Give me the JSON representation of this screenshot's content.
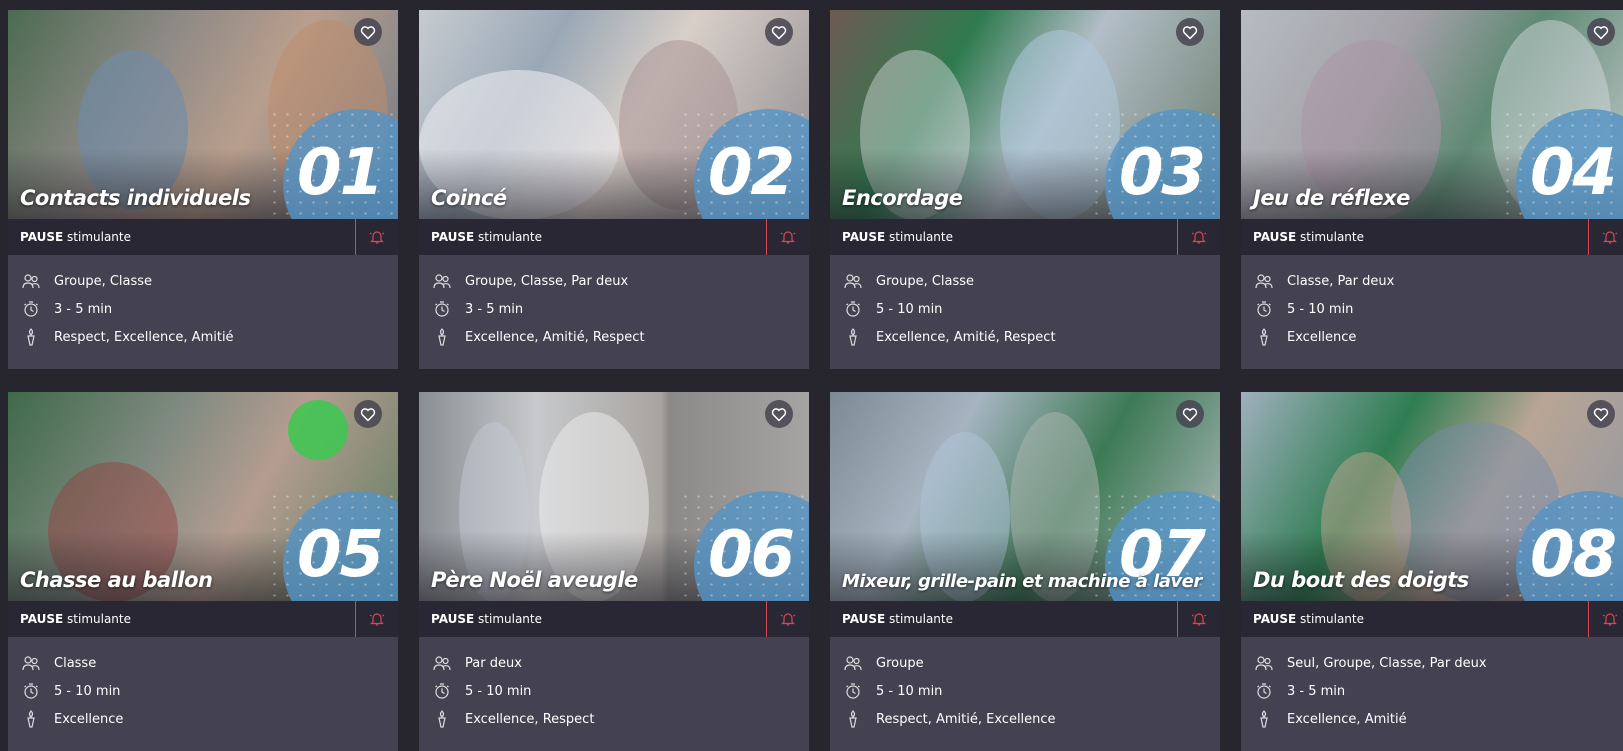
{
  "icons": {
    "favorite": "heart-icon",
    "pause": "bell-icon",
    "participants": "group-icon",
    "duration": "timer-icon",
    "values": "torch-icon"
  },
  "colors": {
    "accent": "#d94656",
    "circle": "#5694c4",
    "card": "#444150",
    "bar": "#292733"
  },
  "cards": [
    {
      "title": "Contacts individuels",
      "number": "01",
      "type_bold": "PAUSE",
      "type_rest": "stimulante",
      "participants": "Groupe, Classe",
      "duration": "3 - 5 min",
      "values": "Respect, Excellence, Amitié"
    },
    {
      "title": "Coincé",
      "number": "02",
      "type_bold": "PAUSE",
      "type_rest": "stimulante",
      "participants": "Groupe, Classe, Par deux",
      "duration": "3 - 5 min",
      "values": "Excellence, Amitié, Respect"
    },
    {
      "title": "Encordage",
      "number": "03",
      "type_bold": "PAUSE",
      "type_rest": "stimulante",
      "participants": "Groupe, Classe",
      "duration": "5 - 10 min",
      "values": "Excellence, Amitié, Respect"
    },
    {
      "title": "Jeu de réflexe",
      "number": "04",
      "type_bold": "PAUSE",
      "type_rest": "stimulante",
      "participants": "Classe, Par deux",
      "duration": "5 - 10 min",
      "values": "Excellence"
    },
    {
      "title": "Chasse au ballon",
      "number": "05",
      "type_bold": "PAUSE",
      "type_rest": "stimulante",
      "participants": "Classe",
      "duration": "5 - 10 min",
      "values": "Excellence"
    },
    {
      "title": "Père Noël aveugle",
      "number": "06",
      "type_bold": "PAUSE",
      "type_rest": "stimulante",
      "participants": "Par deux",
      "duration": "5 - 10 min",
      "values": "Excellence, Respect"
    },
    {
      "title": "Mixeur, grille-pain et machine à laver",
      "number": "07",
      "type_bold": "PAUSE",
      "type_rest": "stimulante",
      "participants": "Groupe",
      "duration": "5 - 10 min",
      "values": "Respect, Amitié, Excellence"
    },
    {
      "title": "Du bout des doigts",
      "number": "08",
      "type_bold": "PAUSE",
      "type_rest": "stimulante",
      "participants": "Seul, Groupe, Classe, Par deux",
      "duration": "3 - 5 min",
      "values": "Excellence, Amitié"
    }
  ]
}
